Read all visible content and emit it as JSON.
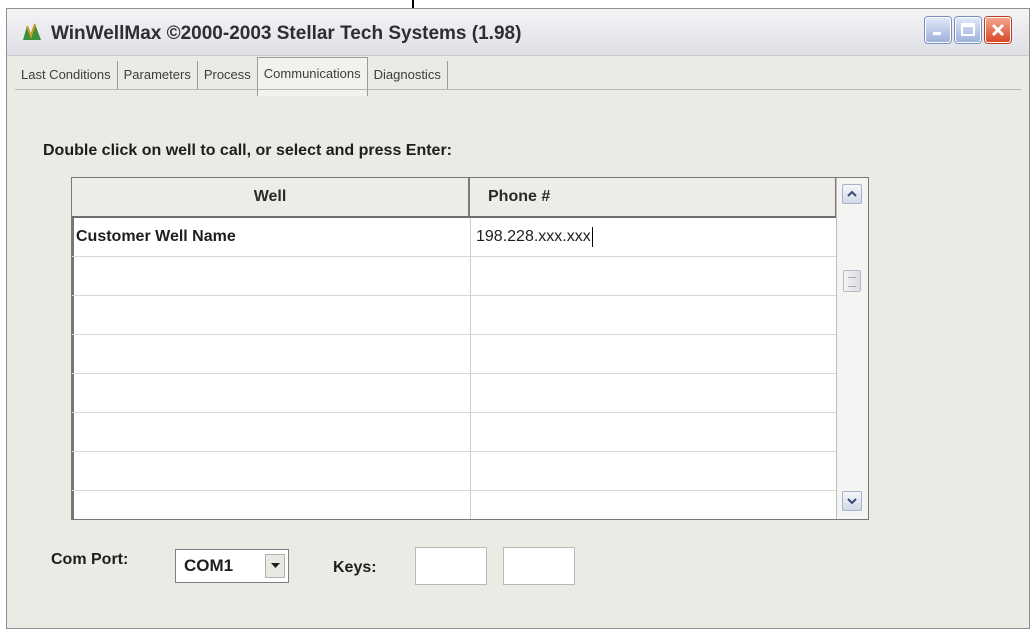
{
  "window": {
    "title": "WinWellMax  ©2000-2003 Stellar Tech Systems (1.98)"
  },
  "tabs": [
    {
      "label": "Last Conditions",
      "active": false
    },
    {
      "label": "Parameters",
      "active": false
    },
    {
      "label": "Process",
      "active": false
    },
    {
      "label": "Communications",
      "active": true
    },
    {
      "label": "Diagnostics",
      "active": false
    }
  ],
  "instruction": "Double click on well to call, or select and press Enter:",
  "grid": {
    "columns": [
      "Well",
      "Phone #"
    ],
    "rows": [
      {
        "well": "Customer Well Name",
        "phone": "198.228.xxx.xxx"
      },
      {
        "well": "",
        "phone": ""
      },
      {
        "well": "",
        "phone": ""
      },
      {
        "well": "",
        "phone": ""
      },
      {
        "well": "",
        "phone": ""
      },
      {
        "well": "",
        "phone": ""
      },
      {
        "well": "",
        "phone": ""
      },
      {
        "well": "",
        "phone": ""
      }
    ]
  },
  "com_port": {
    "label": "Com Port:",
    "value": "COM1"
  },
  "keys": {
    "label": "Keys:",
    "values": [
      "",
      ""
    ]
  },
  "colors": {
    "window_bg": "#eceae4",
    "close_button": "#d9472a",
    "title_text": "#2d2d35"
  },
  "icons": [
    "app-icon",
    "minimize-icon",
    "maximize-icon",
    "close-icon",
    "scroll-up-icon",
    "scroll-down-icon",
    "dropdown-arrow-icon",
    "annotation-arrow"
  ]
}
